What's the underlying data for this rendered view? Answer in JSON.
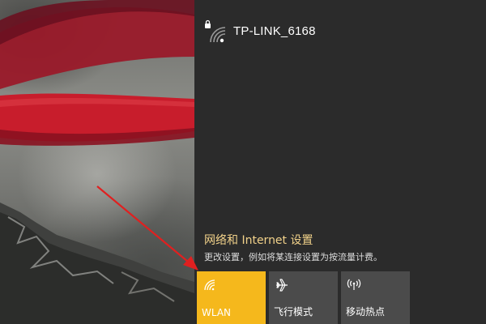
{
  "network": {
    "ssid": "TP-LINK_6168",
    "icon": "wifi-secured-icon"
  },
  "settings": {
    "link_label": "网络和 Internet 设置",
    "description": "更改设置，例如将某连接设置为按流量计费。"
  },
  "quick_actions": [
    {
      "label": "WLAN",
      "icon": "wifi-icon",
      "active": true
    },
    {
      "label": "飞行模式",
      "icon": "airplane-icon",
      "active": false
    },
    {
      "label": "移动热点",
      "icon": "hotspot-icon",
      "active": false
    }
  ],
  "colors": {
    "panel_bg": "#2b2b2b",
    "accent": "#f5b81c",
    "tile_inactive": "#4b4b4b",
    "link": "#f2d28a",
    "annotation_arrow": "#e02020"
  }
}
